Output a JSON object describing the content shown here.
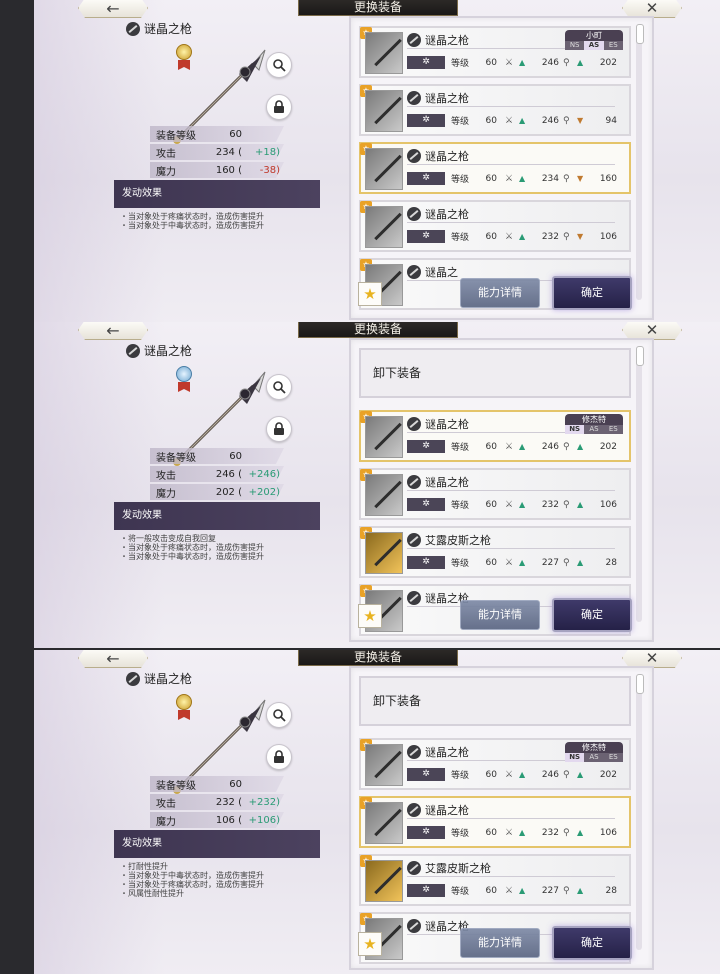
{
  "screens": [
    {
      "topbar": {
        "back_icon": "←",
        "title": "更换装备",
        "close_icon": "✕"
      },
      "item_name": "谜晶之枪",
      "medal": "gold",
      "stats": [
        {
          "label": "装备等级",
          "value": "60",
          "delta": "",
          "trend": ""
        },
        {
          "label": "攻击",
          "value": "234 (",
          "delta": "+18)",
          "trend": "up"
        },
        {
          "label": "魔力",
          "value": "160 (",
          "delta": "-38)",
          "trend": "down"
        }
      ],
      "effect_title": "发动效果",
      "effects": [
        "・当对象处于疼痛状态时，造成伤害提升",
        "・当对象处于中毒状态时，造成伤害提升"
      ],
      "show_unequip": false,
      "unequip_label": "",
      "cards": [
        {
          "name": "谜晶之枪",
          "thumb": "silver",
          "sel": false,
          "level_label": "等级",
          "level": "60",
          "atk": "246",
          "atk_trend": "up",
          "mag": "202",
          "mag_trend": "up",
          "owner": "小町",
          "classes": [
            "NS",
            "AS",
            "ES"
          ],
          "class_on": 1
        },
        {
          "name": "谜晶之枪",
          "thumb": "silver",
          "sel": false,
          "level_label": "等级",
          "level": "60",
          "atk": "246",
          "atk_trend": "up",
          "mag": "94",
          "mag_trend": "down",
          "owner": "",
          "classes": [],
          "class_on": -1
        },
        {
          "name": "谜晶之枪",
          "thumb": "silver",
          "sel": true,
          "level_label": "等级",
          "level": "60",
          "atk": "234",
          "atk_trend": "up",
          "mag": "160",
          "mag_trend": "down",
          "owner": "",
          "classes": [],
          "class_on": -1
        },
        {
          "name": "谜晶之枪",
          "thumb": "silver",
          "sel": false,
          "level_label": "等级",
          "level": "60",
          "atk": "232",
          "atk_trend": "up",
          "mag": "106",
          "mag_trend": "down",
          "owner": "",
          "classes": [],
          "class_on": -1
        },
        {
          "name": "谜晶之",
          "thumb": "silver",
          "sel": false,
          "level_label": "",
          "level": "",
          "atk": "",
          "atk_trend": "",
          "mag": "",
          "mag_trend": "",
          "owner": "",
          "classes": [],
          "class_on": -1
        }
      ],
      "fav_icon": "★",
      "detail_label": "能力详情",
      "confirm_label": "确定"
    },
    {
      "topbar": {
        "back_icon": "←",
        "title": "更换装备",
        "close_icon": "✕"
      },
      "item_name": "谜晶之枪",
      "medal": "blue",
      "stats": [
        {
          "label": "装备等级",
          "value": "60",
          "delta": "",
          "trend": ""
        },
        {
          "label": "攻击",
          "value": "246 (",
          "delta": "+246)",
          "trend": "up"
        },
        {
          "label": "魔力",
          "value": "202 (",
          "delta": "+202)",
          "trend": "up"
        }
      ],
      "effect_title": "发动效果",
      "effects": [
        "・将一般攻击变成自我回复",
        "・当对象处于疼痛状态时，造成伤害提升",
        "・当对象处于中毒状态时，造成伤害提升"
      ],
      "show_unequip": true,
      "unequip_label": "卸下装备",
      "cards": [
        {
          "name": "谜晶之枪",
          "thumb": "silver",
          "sel": true,
          "level_label": "等级",
          "level": "60",
          "atk": "246",
          "atk_trend": "up",
          "mag": "202",
          "mag_trend": "up",
          "owner": "修杰特",
          "classes": [
            "NS",
            "AS",
            "ES"
          ],
          "class_on": 0
        },
        {
          "name": "谜晶之枪",
          "thumb": "silver",
          "sel": false,
          "level_label": "等级",
          "level": "60",
          "atk": "232",
          "atk_trend": "up",
          "mag": "106",
          "mag_trend": "up",
          "owner": "",
          "classes": [],
          "class_on": -1
        },
        {
          "name": "艾露皮斯之枪",
          "thumb": "gold",
          "sel": false,
          "level_label": "等级",
          "level": "60",
          "atk": "227",
          "atk_trend": "up",
          "mag": "28",
          "mag_trend": "up",
          "owner": "",
          "classes": [],
          "class_on": -1
        },
        {
          "name": "谜晶之枪",
          "thumb": "silver",
          "sel": false,
          "level_label": "",
          "level": "",
          "atk": "",
          "atk_trend": "",
          "mag": "",
          "mag_trend": "",
          "owner": "",
          "classes": [],
          "class_on": -1
        }
      ],
      "fav_icon": "★",
      "detail_label": "能力详情",
      "confirm_label": "确定"
    },
    {
      "topbar": {
        "back_icon": "←",
        "title": "更换装备",
        "close_icon": "✕"
      },
      "item_name": "谜晶之枪",
      "medal": "gold",
      "stats": [
        {
          "label": "装备等级",
          "value": "60",
          "delta": "",
          "trend": ""
        },
        {
          "label": "攻击",
          "value": "232 (",
          "delta": "+232)",
          "trend": "up"
        },
        {
          "label": "魔力",
          "value": "106 (",
          "delta": "+106)",
          "trend": "up"
        }
      ],
      "effect_title": "发动效果",
      "effects": [
        "・打耐性提升",
        "・当对象处于中毒状态时，造成伤害提升",
        "・当对象处于疼痛状态时，造成伤害提升",
        "・风属性耐性提升"
      ],
      "show_unequip": true,
      "unequip_label": "卸下装备",
      "cards": [
        {
          "name": "谜晶之枪",
          "thumb": "silver",
          "sel": false,
          "level_label": "等级",
          "level": "60",
          "atk": "246",
          "atk_trend": "up",
          "mag": "202",
          "mag_trend": "up",
          "owner": "修杰特",
          "classes": [
            "NS",
            "AS",
            "ES"
          ],
          "class_on": 0
        },
        {
          "name": "谜晶之枪",
          "thumb": "silver",
          "sel": true,
          "level_label": "等级",
          "level": "60",
          "atk": "232",
          "atk_trend": "up",
          "mag": "106",
          "mag_trend": "up",
          "owner": "",
          "classes": [],
          "class_on": -1
        },
        {
          "name": "艾露皮斯之枪",
          "thumb": "gold",
          "sel": false,
          "level_label": "等级",
          "level": "60",
          "atk": "227",
          "atk_trend": "up",
          "mag": "28",
          "mag_trend": "up",
          "owner": "",
          "classes": [],
          "class_on": -1
        },
        {
          "name": "谜晶之枪",
          "thumb": "silver",
          "sel": false,
          "level_label": "",
          "level": "",
          "atk": "",
          "atk_trend": "",
          "mag": "",
          "mag_trend": "",
          "owner": "",
          "classes": [],
          "class_on": -1
        }
      ],
      "fav_icon": "★",
      "detail_label": "能力详情",
      "confirm_label": "确定"
    }
  ]
}
